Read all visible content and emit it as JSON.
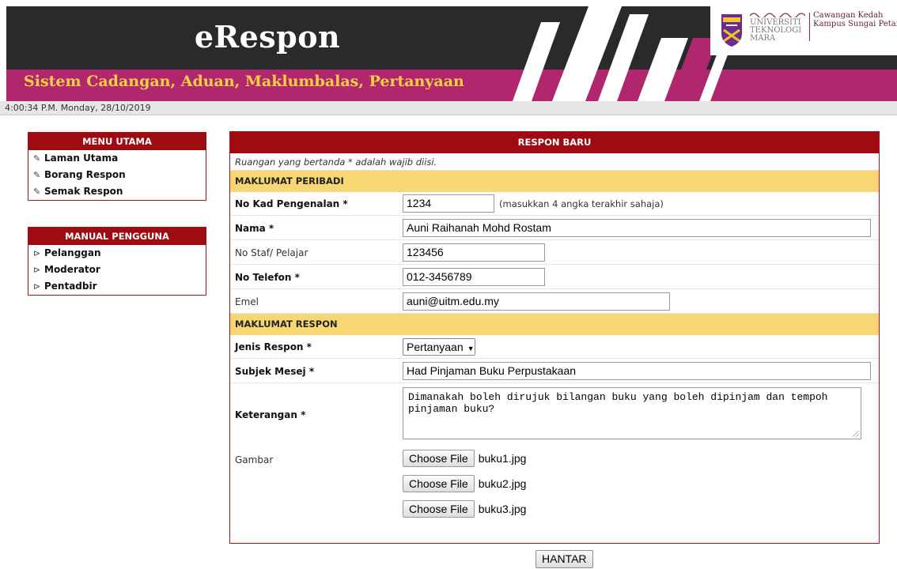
{
  "header": {
    "title": "eRespon",
    "subtitle": "Sistem Cadangan, Aduan, Maklumbalas, Pertanyaan",
    "logo_university_lines": [
      "UNIVERSITI",
      "TEKNOLOGI",
      "MARA"
    ],
    "logo_campus_lines": [
      "Cawangan Kedah",
      "Kampus Sungai Petani"
    ]
  },
  "clock": "4:00:34 P.M. Monday, 28/10/2019",
  "sidebar": {
    "menu_title": "MENU UTAMA",
    "menu_items": [
      {
        "icon": "edit-icon",
        "label": "Laman Utama"
      },
      {
        "icon": "edit-icon",
        "label": "Borang Respon"
      },
      {
        "icon": "edit-icon",
        "label": "Semak Respon"
      }
    ],
    "manual_title": "MANUAL PENGGUNA",
    "manual_items": [
      {
        "icon": "folder-open-icon",
        "label": "Pelanggan"
      },
      {
        "icon": "folder-open-icon",
        "label": "Moderator"
      },
      {
        "icon": "folder-open-icon",
        "label": "Pentadbir"
      }
    ]
  },
  "form": {
    "title": "RESPON BARU",
    "required_note": "Ruangan yang bertanda * adalah wajib diisi.",
    "section_personal": "MAKLUMAT PERIBADI",
    "ic_label": "No Kad Pengenalan *",
    "ic_value": "1234",
    "ic_hint": "(masukkan 4 angka terakhir sahaja)",
    "name_label": "Nama *",
    "name_value": "Auni Raihanah Mohd Rostam",
    "staff_label": "No Staf/ Pelajar",
    "staff_value": "123456",
    "phone_label": "No Telefon *",
    "phone_value": "012-3456789",
    "email_label": "Emel",
    "email_value": "auni@uitm.edu.my",
    "section_response": "MAKLUMAT RESPON",
    "type_label": "Jenis Respon *",
    "type_value": "Pertanyaan",
    "subject_label": "Subjek Mesej *",
    "subject_value": "Had Pinjaman Buku Perpustakaan",
    "desc_label": "Keterangan *",
    "desc_value": "Dimanakah boleh dirujuk bilangan buku yang boleh dipinjam dan tempoh pinjaman buku?",
    "image_label": "Gambar",
    "file_button_label": "Choose File",
    "files": [
      "buku1.jpg",
      "buku2.jpg",
      "buku3.jpg"
    ],
    "submit_label": "HANTAR"
  },
  "colors": {
    "banner_dark": "#2a2a2c",
    "banner_magenta": "#b0276e",
    "subtitle_yellow": "#f6cf45",
    "panel_red": "#9e0b11",
    "section_yellow": "#f8d772"
  }
}
